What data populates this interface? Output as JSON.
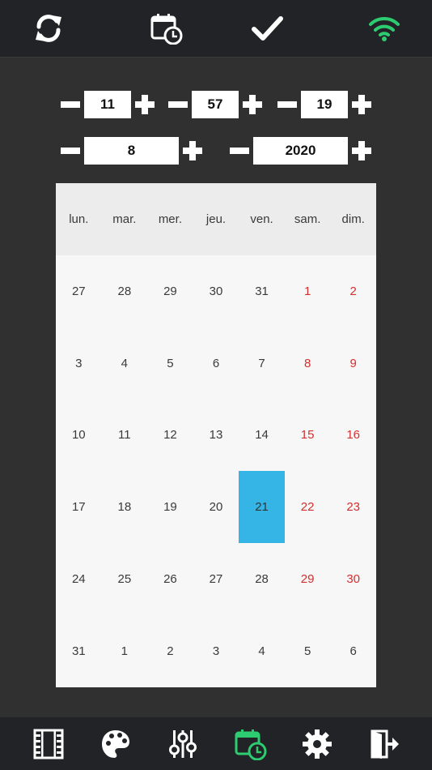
{
  "colors": {
    "accent_green": "#2ecc71",
    "selected": "#35b5e5",
    "weekend": "#d32f2f"
  },
  "toolbar": {
    "icons": [
      "refresh-icon",
      "calendar-clock-icon",
      "checkmark-icon",
      "wifi-icon"
    ]
  },
  "time": {
    "hour": "11",
    "minute": "57",
    "second": "19"
  },
  "date": {
    "month": "8",
    "year": "2020"
  },
  "calendar": {
    "weekdays": [
      "lun.",
      "mar.",
      "mer.",
      "jeu.",
      "ven.",
      "sam.",
      "dim."
    ],
    "weeks": [
      [
        "27",
        "28",
        "29",
        "30",
        "31",
        "1",
        "2"
      ],
      [
        "3",
        "4",
        "5",
        "6",
        "7",
        "8",
        "9"
      ],
      [
        "10",
        "11",
        "12",
        "13",
        "14",
        "15",
        "16"
      ],
      [
        "17",
        "18",
        "19",
        "20",
        "21",
        "22",
        "23"
      ],
      [
        "24",
        "25",
        "26",
        "27",
        "28",
        "29",
        "30"
      ],
      [
        "31",
        "1",
        "2",
        "3",
        "4",
        "5",
        "6"
      ]
    ],
    "selected": "21"
  },
  "bottombar": {
    "icons": [
      "film-icon",
      "palette-icon",
      "sliders-icon",
      "calendar-clock-icon",
      "gear-icon",
      "exit-icon"
    ],
    "active": "calendar-clock-icon"
  }
}
